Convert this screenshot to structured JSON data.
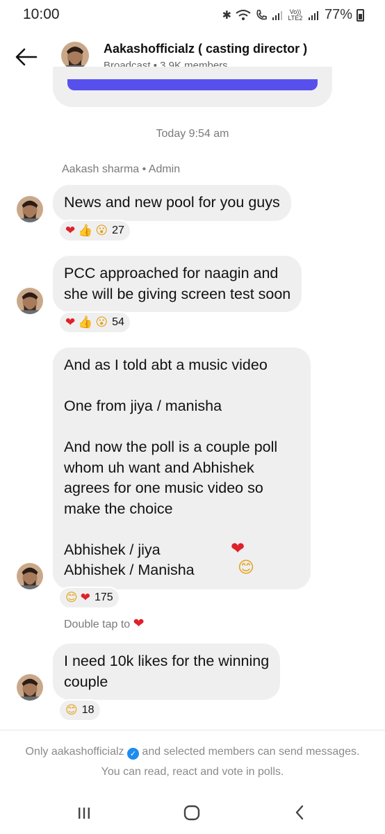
{
  "status_bar": {
    "time": "10:00",
    "volte": "Vo)) LTE2",
    "battery_pct": "77%"
  },
  "header": {
    "title": "Aakashofficialz ( casting director )",
    "subtitle": "Broadcast • 3.9K members"
  },
  "chat": {
    "day_stamp": "Today 9:54 am",
    "sender": "Aakash sharma • Admin",
    "messages": [
      {
        "lines": [
          "News and new pool for you guys"
        ],
        "reactions": [
          "heart",
          "thumbs-up",
          "surprised"
        ],
        "count": "27"
      },
      {
        "lines": [
          "PCC approached for naagin and",
          "she will be giving screen test soon"
        ],
        "reactions": [
          "heart",
          "thumbs-up",
          "surprised"
        ],
        "count": "54"
      },
      {
        "lines": [
          "And as I told abt a music video",
          "",
          "One from jiya / manisha",
          "",
          "And now the poll is a couple poll",
          "whom uh want and Abhishek",
          "agrees for one music video so",
          "make the choice",
          "",
          "Abhishek / jiya",
          "Abhishek / Manisha"
        ],
        "reactions": [
          "smile",
          "heart"
        ],
        "count": "175"
      },
      {
        "lines": [
          "I need 10k likes for the winning",
          "couple"
        ],
        "reactions": [
          "smile"
        ],
        "count": "18"
      }
    ],
    "double_tap": "Double tap to"
  },
  "footer": {
    "notice_prefix": "Only aakashofficialz",
    "notice_suffix": " and selected members can send messages. You can read, react and vote in polls."
  },
  "colors": {
    "bubble": "#efefef",
    "accent": "#5850ec",
    "heart": "#e0202a",
    "verified": "#1d8cf0"
  }
}
